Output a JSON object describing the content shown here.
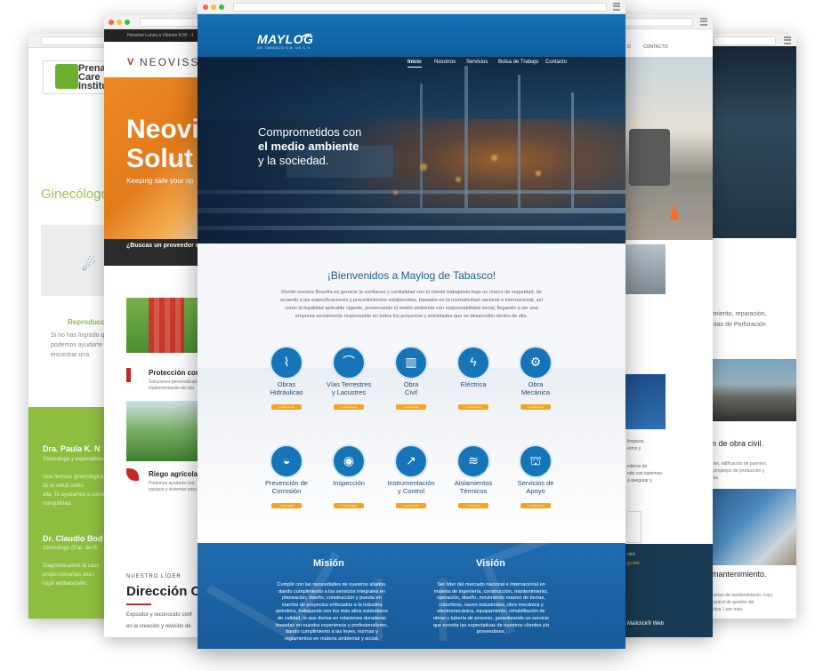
{
  "left_site": {
    "logo_lines": [
      "Prenat",
      "Care",
      "Institu"
    ],
    "heading": "Ginecólogo",
    "section_label": "Reproducci",
    "section_text": [
      "Si no has logrado que",
      "podemos ayudarte a ",
      "encontrar una"
    ],
    "doctor1_name": "Dra. Paula K. N",
    "doctor1_role": "Ginecóloga y especialista",
    "doctor1_text": [
      "Una revisión ginecológica",
      "de tu salud como",
      "ella. Te ayudamos a conoc",
      "tranquilidad."
    ],
    "doctor2_name": "Dr. Claudio Bod",
    "doctor2_role": "Ginecólogo (Esp. de Ri",
    "doctor2_text": [
      "Diagnosticamos la caus",
      "proporcionamos una t",
      "lugar embarazarte."
    ]
  },
  "neoviss_site": {
    "topbar_text": "Horarios  Lunes a Viernes 8:00 - 1",
    "brand_name": "NEOVISS",
    "hero_line1": "Neovi",
    "hero_line2": "Solut",
    "hero_sub": "Keeping safe your op",
    "dark_question": "¿Buscas un proveedor d",
    "item1_title": "Protección contr",
    "item1_text": [
      "Soluciones personalizad",
      "implementación de sist"
    ],
    "item2_title": "Riego agrícola",
    "item2_text": [
      "Podemos ayudarte con ",
      "equipos y sistemas para"
    ],
    "leader_label": "NUESTRO LÍDER",
    "leader_title": "Dirección C",
    "leader_text1": "Expositor y reconocido conf",
    "leader_text2": "en la creación y revisión de"
  },
  "right_front_site": {
    "nav_items": [
      "O",
      "CONTACTO"
    ],
    "text1": [
      "limpieza,",
      "ermo y"
    ],
    "text2": [
      "ederos de",
      "ndo con sistemas",
      "a asegurar y"
    ],
    "footer_line1": "nico",
    "footer_line2": "g.com",
    "footer_line3": "Mailclick® Web"
  },
  "right_back_site": {
    "text1": [
      "imiento, reparación,",
      "ntas de Perforación"
    ],
    "title2": "n de obra civil.",
    "text2": [
      "nes, edificación de puentes,",
      "complejos de producción y",
      "ras."
    ],
    "title3": "mantenimiento.",
    "text3": [
      "cartas de mantenimiento, cuyo",
      "control de gestión del",
      "ctiva. Leer más."
    ]
  },
  "maylog": {
    "logo": "MAYLOG",
    "logo_sub": "DE TABASCO S.A. DE C.V.",
    "nav": [
      {
        "label": "Inicio",
        "active": true
      },
      {
        "label": "Nosotros",
        "active": false
      },
      {
        "label": "Servicios",
        "active": false
      },
      {
        "label": "Bolsa de Trabajo",
        "active": false
      },
      {
        "label": "Contacto",
        "active": false
      }
    ],
    "hero": {
      "line1": "Comprometidos con",
      "line2": "el medio ambiente",
      "line3": "y la sociedad."
    },
    "welcome_title": "¡Bienvenidos a Maylog de Tabasco!",
    "welcome_text": "Donde nuestra filosofía es generar la confianza y cordialidad con el cliente trabajando bajo un marco de seguridad, de acuerdo a las especificaciones y procedimientos establecidos, basados en la normatividad nacional e internacional, así como la legalidad aplicable vigente, preservando el medio ambiente con responsabilidad social, llegando a ser una empresa socialmente responsable en todos los proyectos y actividades que se desarrollen dentro de ella.",
    "services": [
      {
        "line1": "Obras",
        "line2": "Hidráulicas",
        "icon": "pipe-icon",
        "glyph": "⌇"
      },
      {
        "line1": "Vías Terrestres",
        "line2": "y Lacustres",
        "icon": "bridge-icon",
        "glyph": "⌒"
      },
      {
        "line1": "Obra",
        "line2": "Civil",
        "icon": "building-icon",
        "glyph": "▥"
      },
      {
        "line1": "Eléctrica",
        "line2": "",
        "icon": "cable-icon",
        "glyph": "ϟ"
      },
      {
        "line1": "Obra",
        "line2": "Mecánica",
        "icon": "valve-icon",
        "glyph": "⚙"
      },
      {
        "line1": "Prevención de",
        "line2": "Corrosión",
        "icon": "drop-icon",
        "glyph": "◒"
      },
      {
        "line1": "Inspección",
        "line2": "",
        "icon": "sonar-icon",
        "glyph": "◉"
      },
      {
        "line1": "Instrumentación",
        "line2": "y Control",
        "icon": "chart-icon",
        "glyph": "↗"
      },
      {
        "line1": "Aislamientos",
        "line2": "Térmicos",
        "icon": "heat-icon",
        "glyph": "≋"
      },
      {
        "line1": "Servicios de",
        "line2": "Apoyo",
        "icon": "platform-icon",
        "glyph": "⛫"
      }
    ],
    "service_button": "+ información",
    "mission_title": "Misión",
    "mission_text": "Cumplir con las necesidades de nuestros aliados, dando cumplimiento a los servicios integrales en planeación, diseño, construcción y puesta en marcha de proyectos enfocados a la industria petrolera, trabajando con los más altos estándares de calidad, lo que deriva en relaciones duraderas basadas en nuestra experiencia y profesionalismo, dando cumplimiento a las leyes, normas y reglamentos en materia ambiental y social.",
    "vision_title": "Visión",
    "vision_text": "Ser líder del mercado nacional e internacional en materia de ingeniería, construcción, mantenimiento, operación, diseño, movimiento masivo de tierras, cobertizos, naves industriales, obra mecánica y electromecánica, equipamiento, rehabilitación de obras y tubería de proceso, garantizando un servicio que exceda las expectativas de nuestros clientes y/o proveedores."
  }
}
